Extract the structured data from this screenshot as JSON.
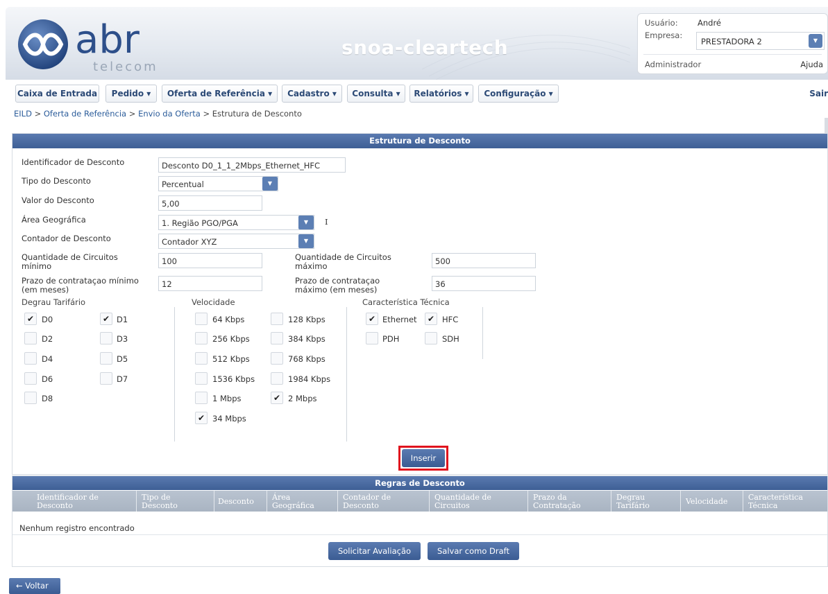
{
  "header": {
    "logo_text": "abr",
    "logo_sub": "telecom",
    "app_title": "snoa-cleartech",
    "user_label": "Usuário:",
    "user_value": "André",
    "company_label": "Empresa:",
    "company_value": "PRESTADORA 2",
    "role": "Administrador",
    "help": "Ajuda"
  },
  "menu": {
    "items": [
      "Caixa de Entrada",
      "Pedido ▾",
      "Oferta de Referência ▾",
      "Cadastro ▾",
      "Consulta ▾",
      "Relatórios ▾",
      "Configuração ▾"
    ],
    "exit": "Sair"
  },
  "breadcrumb": {
    "items": [
      "EILD",
      "Oferta de Referência",
      "Envio da Oferta"
    ],
    "current": "Estrutura de Desconto",
    "sep": ">"
  },
  "form": {
    "title": "Estrutura de Desconto",
    "id_label": "Identificador de Desconto",
    "id_value": "Desconto D0_1_1_2Mbps_Ethernet_HFC",
    "type_label": "Tipo do Desconto",
    "type_value": "Percentual",
    "value_label": "Valor do Desconto",
    "value_value": "5,00",
    "area_label": "Área Geográfica",
    "area_value": "1. Região PGO/PGA",
    "area_cursor": "I",
    "counter_label": "Contador de Desconto",
    "counter_value": "Contador XYZ",
    "qmin_label_1": "Quantidade de Circuitos",
    "qmin_label_2": "mínimo",
    "qmin_value": "100",
    "qmax_label_1": "Quantidade de Circuitos",
    "qmax_label_2": "máximo",
    "qmax_value": "500",
    "pmin_label_1": "Prazo de contrataçao mínimo",
    "pmin_label_2": "(em meses)",
    "pmin_value": "12",
    "pmax_label_1": "Prazo de contrataçao",
    "pmax_label_2": "máximo (em meses)",
    "pmax_value": "36",
    "tier_group": "Degrau Tarifário",
    "speed_group": "Velocidade",
    "tech_group": "Característica Técnica",
    "tiers": [
      {
        "label": "D0",
        "checked": true
      },
      {
        "label": "D1",
        "checked": true
      },
      {
        "label": "D2",
        "checked": false
      },
      {
        "label": "D3",
        "checked": false
      },
      {
        "label": "D4",
        "checked": false
      },
      {
        "label": "D5",
        "checked": false
      },
      {
        "label": "D6",
        "checked": false
      },
      {
        "label": "D7",
        "checked": false
      },
      {
        "label": "D8",
        "checked": false
      }
    ],
    "speeds": [
      {
        "label": "64 Kbps",
        "checked": false
      },
      {
        "label": "128 Kbps",
        "checked": false
      },
      {
        "label": "256 Kbps",
        "checked": false
      },
      {
        "label": "384 Kbps",
        "checked": false
      },
      {
        "label": "512 Kbps",
        "checked": false
      },
      {
        "label": "768 Kbps",
        "checked": false
      },
      {
        "label": "1536 Kbps",
        "checked": false
      },
      {
        "label": "1984 Kbps",
        "checked": false
      },
      {
        "label": "1 Mbps",
        "checked": false
      },
      {
        "label": "2 Mbps",
        "checked": true
      },
      {
        "label": "34 Mbps",
        "checked": true
      }
    ],
    "techs": [
      {
        "label": "Ethernet",
        "checked": true
      },
      {
        "label": "HFC",
        "checked": true
      },
      {
        "label": "PDH",
        "checked": false
      },
      {
        "label": "SDH",
        "checked": false
      }
    ],
    "check_glyph": "✔",
    "insert_label": "Inserir"
  },
  "rules": {
    "title": "Regras de Desconto",
    "columns": [
      [
        "Identificador de",
        "Desconto"
      ],
      [
        "Tipo de",
        "Desconto"
      ],
      [
        "Desconto",
        ""
      ],
      [
        "Área",
        "Geográfica"
      ],
      [
        "Contador de",
        "Desconto"
      ],
      [
        "Quantidade de",
        "Circuitos"
      ],
      [
        "Prazo da",
        "Contratação"
      ],
      [
        "Degrau",
        "Tarifário"
      ],
      [
        "Velocidade",
        ""
      ],
      [
        "Característica",
        "Técnica"
      ]
    ],
    "empty": "Nenhum registro encontrado",
    "request_eval": "Solicitar Avaliação",
    "save_draft": "Salvar como Draft"
  },
  "footer": {
    "back": "← Voltar"
  },
  "colors": {
    "accent": "#3e5f95",
    "highlight": "#e0141e"
  }
}
